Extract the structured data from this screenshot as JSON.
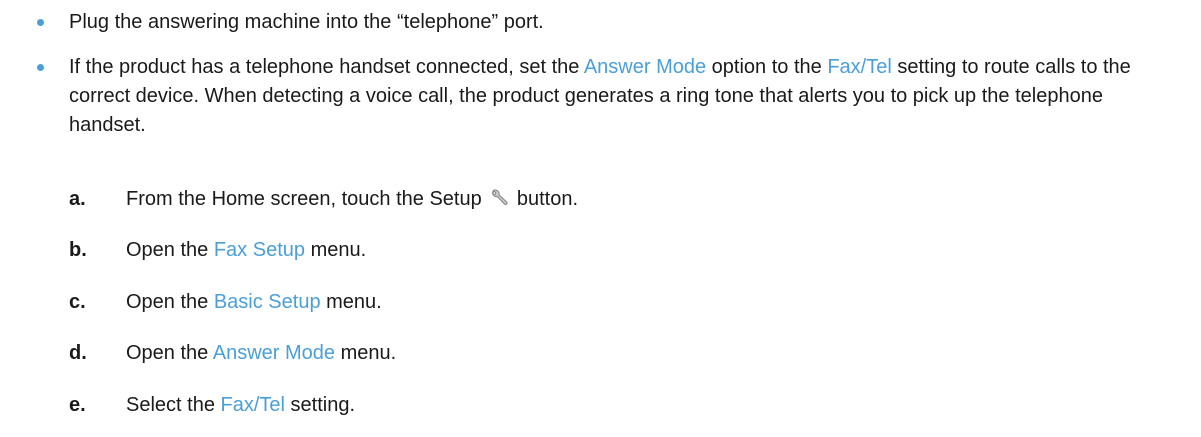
{
  "bullets": [
    {
      "text": "Plug the answering machine into the “telephone” port."
    },
    {
      "p1": "If the product has a telephone handset connected, set the ",
      "link1": "Answer Mode",
      "p2": " option to the ",
      "link2": "Fax/Tel",
      "p3": " setting to route calls to the correct device. When detecting a voice call, the product generates a ring tone that alerts you to pick up the telephone handset."
    }
  ],
  "steps": [
    {
      "letter": "a.",
      "pre": "From the Home screen, touch the Setup ",
      "icon": "wrench-icon",
      "post": " button."
    },
    {
      "letter": "b.",
      "pre": "Open the ",
      "link": "Fax Setup",
      "post": " menu."
    },
    {
      "letter": "c.",
      "pre": "Open the ",
      "link": "Basic Setup",
      "post": " menu."
    },
    {
      "letter": "d.",
      "pre": "Open the ",
      "link": "Answer Mode",
      "post": " menu."
    },
    {
      "letter": "e.",
      "pre": "Select the ",
      "link": "Fax/Tel",
      "post": " setting."
    }
  ],
  "colors": {
    "accent": "#4a9fd8",
    "text": "#1a1a1a"
  }
}
